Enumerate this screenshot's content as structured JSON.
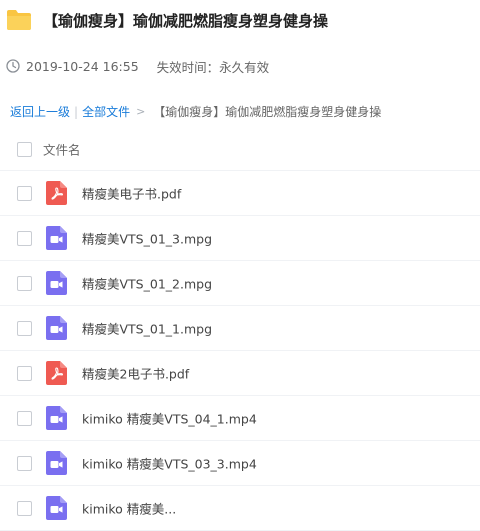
{
  "share": {
    "title": "【瑜伽瘦身】瑜伽减肥燃脂瘦身塑身健身操",
    "created": "2019-10-24 16:55",
    "expire": "失效时间：永久有效"
  },
  "breadcrumb": {
    "back": "返回上一级",
    "separator": "|",
    "all_files": "全部文件",
    "arrow": ">",
    "current": "【瑜伽瘦身】瑜伽减肥燃脂瘦身塑身健身操"
  },
  "table": {
    "column_header": "文件名",
    "files": [
      {
        "name": "精瘦美电子书.pdf",
        "type": "pdf"
      },
      {
        "name": "精瘦美VTS_01_3.mpg",
        "type": "video"
      },
      {
        "name": "精瘦美VTS_01_2.mpg",
        "type": "video"
      },
      {
        "name": "精瘦美VTS_01_1.mpg",
        "type": "video"
      },
      {
        "name": "精瘦美2电子书.pdf",
        "type": "pdf"
      },
      {
        "name": "kimiko 精瘦美VTS_04_1.mp4",
        "type": "video"
      },
      {
        "name": "kimiko 精瘦美VTS_03_3.mp4",
        "type": "video"
      },
      {
        "name": "kimiko 精瘦美...",
        "type": "video"
      }
    ]
  },
  "colors": {
    "link": "#1a7cd9",
    "folder": "#f9c542",
    "pdf": "#ef5a52",
    "video": "#7a6ff0"
  },
  "icons": {
    "folder": "folder-icon",
    "clock": "clock-icon",
    "pdf": "pdf-file-icon",
    "video": "video-file-icon"
  }
}
